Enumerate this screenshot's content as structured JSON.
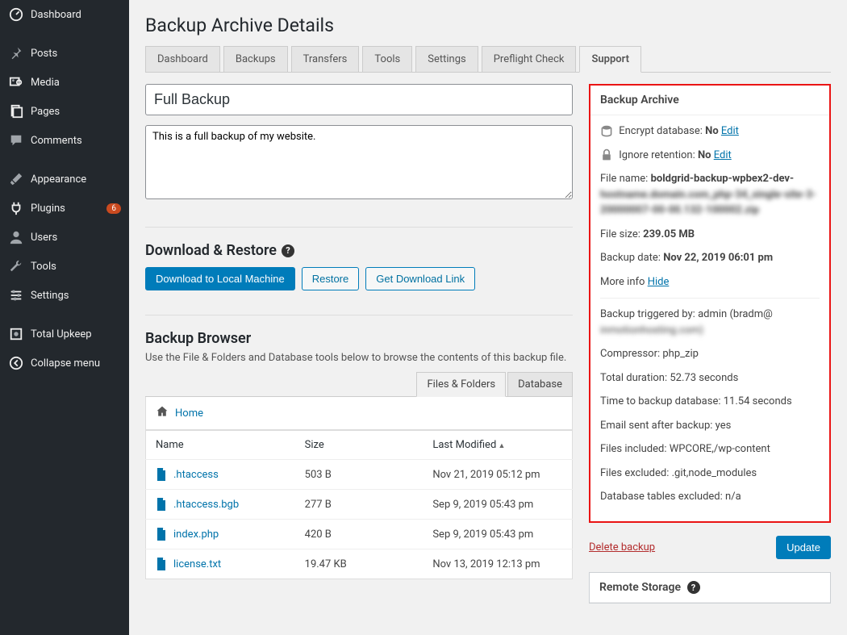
{
  "sidebar": {
    "items": [
      {
        "label": "Dashboard",
        "icon": "dashboard",
        "key": "dashboard"
      },
      {
        "label": "Posts",
        "icon": "pin",
        "key": "posts",
        "sep": true
      },
      {
        "label": "Media",
        "icon": "media",
        "key": "media"
      },
      {
        "label": "Pages",
        "icon": "pages",
        "key": "pages"
      },
      {
        "label": "Comments",
        "icon": "comment",
        "key": "comments"
      },
      {
        "label": "Appearance",
        "icon": "brush",
        "key": "appearance",
        "sep": true
      },
      {
        "label": "Plugins",
        "icon": "plug",
        "key": "plugins",
        "badge": "6"
      },
      {
        "label": "Users",
        "icon": "user",
        "key": "users"
      },
      {
        "label": "Tools",
        "icon": "wrench",
        "key": "tools"
      },
      {
        "label": "Settings",
        "icon": "sliders",
        "key": "settings"
      },
      {
        "label": "Total Upkeep",
        "icon": "shield",
        "key": "totalupkeep",
        "sep": true
      },
      {
        "label": "Collapse menu",
        "icon": "collapse",
        "key": "collapse"
      }
    ]
  },
  "page": {
    "title": "Backup Archive Details",
    "tabs": [
      "Dashboard",
      "Backups",
      "Transfers",
      "Tools",
      "Settings",
      "Preflight Check",
      "Support"
    ],
    "active_tab": "Support",
    "backup_title": "Full Backup",
    "backup_desc": "This is a full backup of my website."
  },
  "download": {
    "heading": "Download & Restore",
    "btn_download": "Download to Local Machine",
    "btn_restore": "Restore",
    "btn_link": "Get Download Link"
  },
  "browser": {
    "heading": "Backup Browser",
    "desc": "Use the File & Folders and Database tools below to browse the contents of this backup file.",
    "tabs": [
      "Files & Folders",
      "Database"
    ],
    "active": "Files & Folders",
    "breadcrumb": "Home",
    "cols": {
      "name": "Name",
      "size": "Size",
      "modified": "Last Modified"
    },
    "rows": [
      {
        "name": ".htaccess",
        "size": "503 B",
        "modified": "Nov 21, 2019 05:12 pm"
      },
      {
        "name": ".htaccess.bgb",
        "size": "277 B",
        "modified": "Sep 9, 2019 05:43 pm"
      },
      {
        "name": "index.php",
        "size": "420 B",
        "modified": "Sep 9, 2019 05:43 pm"
      },
      {
        "name": "license.txt",
        "size": "19.47 KB",
        "modified": "Nov 13, 2019 12:13 pm"
      }
    ]
  },
  "archive": {
    "title": "Backup Archive",
    "encrypt_label": "Encrypt database:",
    "encrypt_value": "No",
    "edit": "Edit",
    "retention_label": "Ignore retention:",
    "retention_value": "No",
    "filename_label": "File name:",
    "filename_visible": "boldgrid-backup-wpbex2-dev-",
    "filename_blurred": "hostname.domain.com_php-34_single-site-3-20000007-00-00.132-100002.zip",
    "filesize_label": "File size:",
    "filesize_value": "239.05 MB",
    "date_label": "Backup date:",
    "date_value": "Nov 22, 2019 06:01 pm",
    "moreinfo_label": "More info",
    "moreinfo_link": "Hide",
    "triggered_label": "Backup triggered by:",
    "triggered_value": "admin (bradm@",
    "triggered_blurred": "inmotionhosting.com)",
    "compressor_label": "Compressor:",
    "compressor_value": "php_zip",
    "duration_label": "Total duration:",
    "duration_value": "52.73 seconds",
    "dbtime_label": "Time to backup database:",
    "dbtime_value": "11.54 seconds",
    "email_label": "Email sent after backup:",
    "email_value": "yes",
    "included_label": "Files included:",
    "included_value": "WPCORE,/wp-content",
    "excluded_label": "Files excluded:",
    "excluded_value": ".git,node_modules",
    "dbexcluded_label": "Database tables excluded:",
    "dbexcluded_value": "n/a"
  },
  "actions": {
    "delete": "Delete backup",
    "update": "Update"
  },
  "remote": {
    "title": "Remote Storage"
  }
}
